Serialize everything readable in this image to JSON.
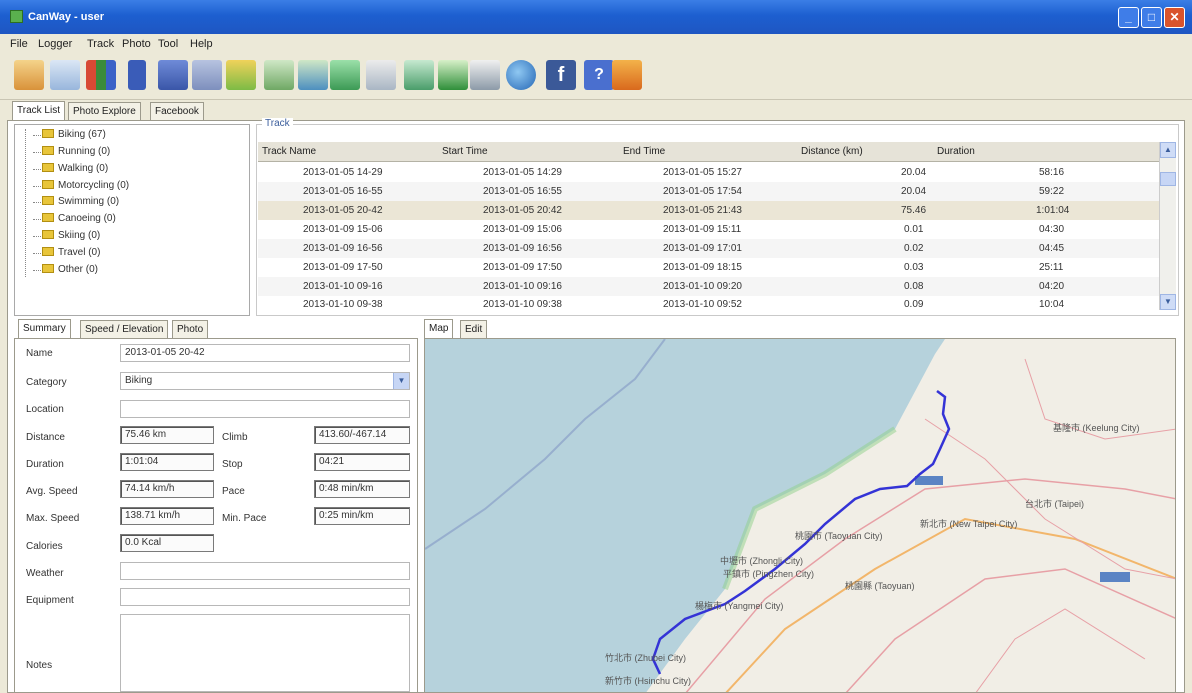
{
  "window": {
    "title": "CanWay - user"
  },
  "menu": [
    "File",
    "Logger",
    "Track",
    "Photo",
    "Tool",
    "Help"
  ],
  "toolbar_icons": [
    "import-icon",
    "track-icon",
    "chart-icon",
    "logger-icon",
    "logger-device-icon",
    "logger-clear-icon",
    "export-icon",
    "photo-map-icon",
    "photo-link-icon",
    "gps-icon",
    "tools-icon",
    "map-icon",
    "refresh-icon",
    "sync-icon",
    "earth-icon",
    "facebook-icon",
    "help-icon",
    "exit-icon"
  ],
  "main_tabs": [
    "Track List",
    "Photo Explore",
    "Facebook"
  ],
  "categories": [
    "Biking (67)",
    "Running (0)",
    "Walking (0)",
    "Motorcycling (0)",
    "Swimming (0)",
    "Canoeing (0)",
    "Skiing (0)",
    "Travel (0)",
    "Other (0)"
  ],
  "track_group_label": "Track",
  "track_columns": [
    "Track Name",
    "Start Time",
    "End Time",
    "Distance (km)",
    "Duration"
  ],
  "tracks": [
    [
      "2013-01-05 14-29",
      "2013-01-05 14:29",
      "2013-01-05 15:27",
      "20.04",
      "58:16"
    ],
    [
      "2013-01-05 16-55",
      "2013-01-05 16:55",
      "2013-01-05 17:54",
      "20.04",
      "59:22"
    ],
    [
      "2013-01-05 20-42",
      "2013-01-05 20:42",
      "2013-01-05 21:43",
      "75.46",
      "1:01:04"
    ],
    [
      "2013-01-09 15-06",
      "2013-01-09 15:06",
      "2013-01-09 15:11",
      "0.01",
      "04:30"
    ],
    [
      "2013-01-09 16-56",
      "2013-01-09 16:56",
      "2013-01-09 17:01",
      "0.02",
      "04:45"
    ],
    [
      "2013-01-09 17-50",
      "2013-01-09 17:50",
      "2013-01-09 18:15",
      "0.03",
      "25:11"
    ],
    [
      "2013-01-10 09-16",
      "2013-01-10 09:16",
      "2013-01-10 09:20",
      "0.08",
      "04:20"
    ],
    [
      "2013-01-10 09-38",
      "2013-01-10 09:38",
      "2013-01-10 09:52",
      "0.09",
      "10:04"
    ]
  ],
  "summary_tabs": [
    "Summary",
    "Speed / Elevation",
    "Photo"
  ],
  "map_tabs": [
    "Map",
    "Edit"
  ],
  "summary": {
    "name_label": "Name",
    "name": "2013-01-05 20-42",
    "category_label": "Category",
    "category": "Biking",
    "location_label": "Location",
    "location": "",
    "distance_label": "Distance",
    "distance": "75.46 km",
    "climb_label": "Climb",
    "climb": "413.60/-467.14",
    "duration_label": "Duration",
    "duration": "1:01:04",
    "stop_label": "Stop",
    "stop": "04:21",
    "avg_speed_label": "Avg. Speed",
    "avg_speed": "74.14 km/h",
    "pace_label": "Pace",
    "pace": "0:48 min/km",
    "max_speed_label": "Max. Speed",
    "max_speed": "138.71 km/h",
    "min_pace_label": "Min. Pace",
    "min_pace": "0:25 min/km",
    "calories_label": "Calories",
    "calories": "0.0 Kcal",
    "weather_label": "Weather",
    "weather": "",
    "equipment_label": "Equipment",
    "equipment": "",
    "notes_label": "Notes",
    "notes": ""
  },
  "map_labels": [
    "基隆市 (Keelung City)",
    "新北市 (New Taipei City)",
    "桃園市 (Taoyuan City)",
    "中壢市 (Zhongli City)",
    "平鎮市 (Pingzhen City)",
    "楊梅市 (Yangmei City)",
    "竹北市 (Zhubei City)",
    "新竹市 (Hsinchu City)",
    "桃園縣 (Taoyuan)",
    "台北市 (Taipei)"
  ],
  "colors": {
    "track": "#3433d6",
    "sea": "#b6d2dc",
    "land": "#f1eee6"
  }
}
